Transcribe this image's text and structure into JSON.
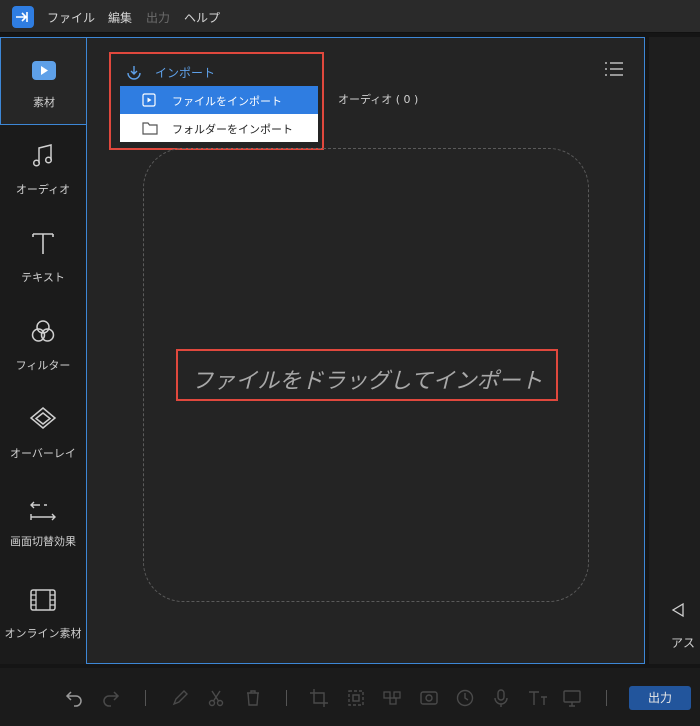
{
  "menubar": {
    "items": [
      {
        "label": "ファイル",
        "enabled": true
      },
      {
        "label": "編集",
        "enabled": true
      },
      {
        "label": "出力",
        "enabled": false
      },
      {
        "label": "ヘルプ",
        "enabled": true
      }
    ]
  },
  "sidebar": {
    "items": [
      {
        "label": "素材",
        "icon": "media-icon",
        "active": true
      },
      {
        "label": "オーディオ",
        "icon": "music-note-icon",
        "active": false
      },
      {
        "label": "テキスト",
        "icon": "text-icon",
        "active": false
      },
      {
        "label": "フィルター",
        "icon": "filter-icon",
        "active": false
      },
      {
        "label": "オーバーレイ",
        "icon": "overlay-icon",
        "active": false
      },
      {
        "label": "画面切替効果",
        "icon": "transition-icon",
        "active": false
      },
      {
        "label": "オンライン素材",
        "icon": "film-icon",
        "active": false
      }
    ]
  },
  "media_panel": {
    "import_label": "インポート",
    "import_menu": [
      {
        "label": "ファイルをインポート",
        "icon": "play-file-icon",
        "highlighted": true
      },
      {
        "label": "フォルダーをインポート",
        "icon": "folder-icon",
        "highlighted": false
      }
    ],
    "audio_tab_label": "オーディオ ( 0 )",
    "drop_hint": "ファイルをドラッグしてインポート"
  },
  "right_panel": {
    "label": "アス"
  },
  "toolbar": {
    "tools": [
      "undo-icon",
      "redo-icon",
      "pen-icon",
      "cut-icon",
      "delete-icon",
      "crop-icon",
      "fit-icon",
      "mosaic-icon",
      "snapshot-icon",
      "speed-icon",
      "voice-icon",
      "tts-icon",
      "screen-icon"
    ],
    "export_label": "出力"
  },
  "colors": {
    "accent": "#2f7de1",
    "highlight_border": "#e0483d",
    "panel_border": "#3d87d6",
    "background": "#242424"
  }
}
